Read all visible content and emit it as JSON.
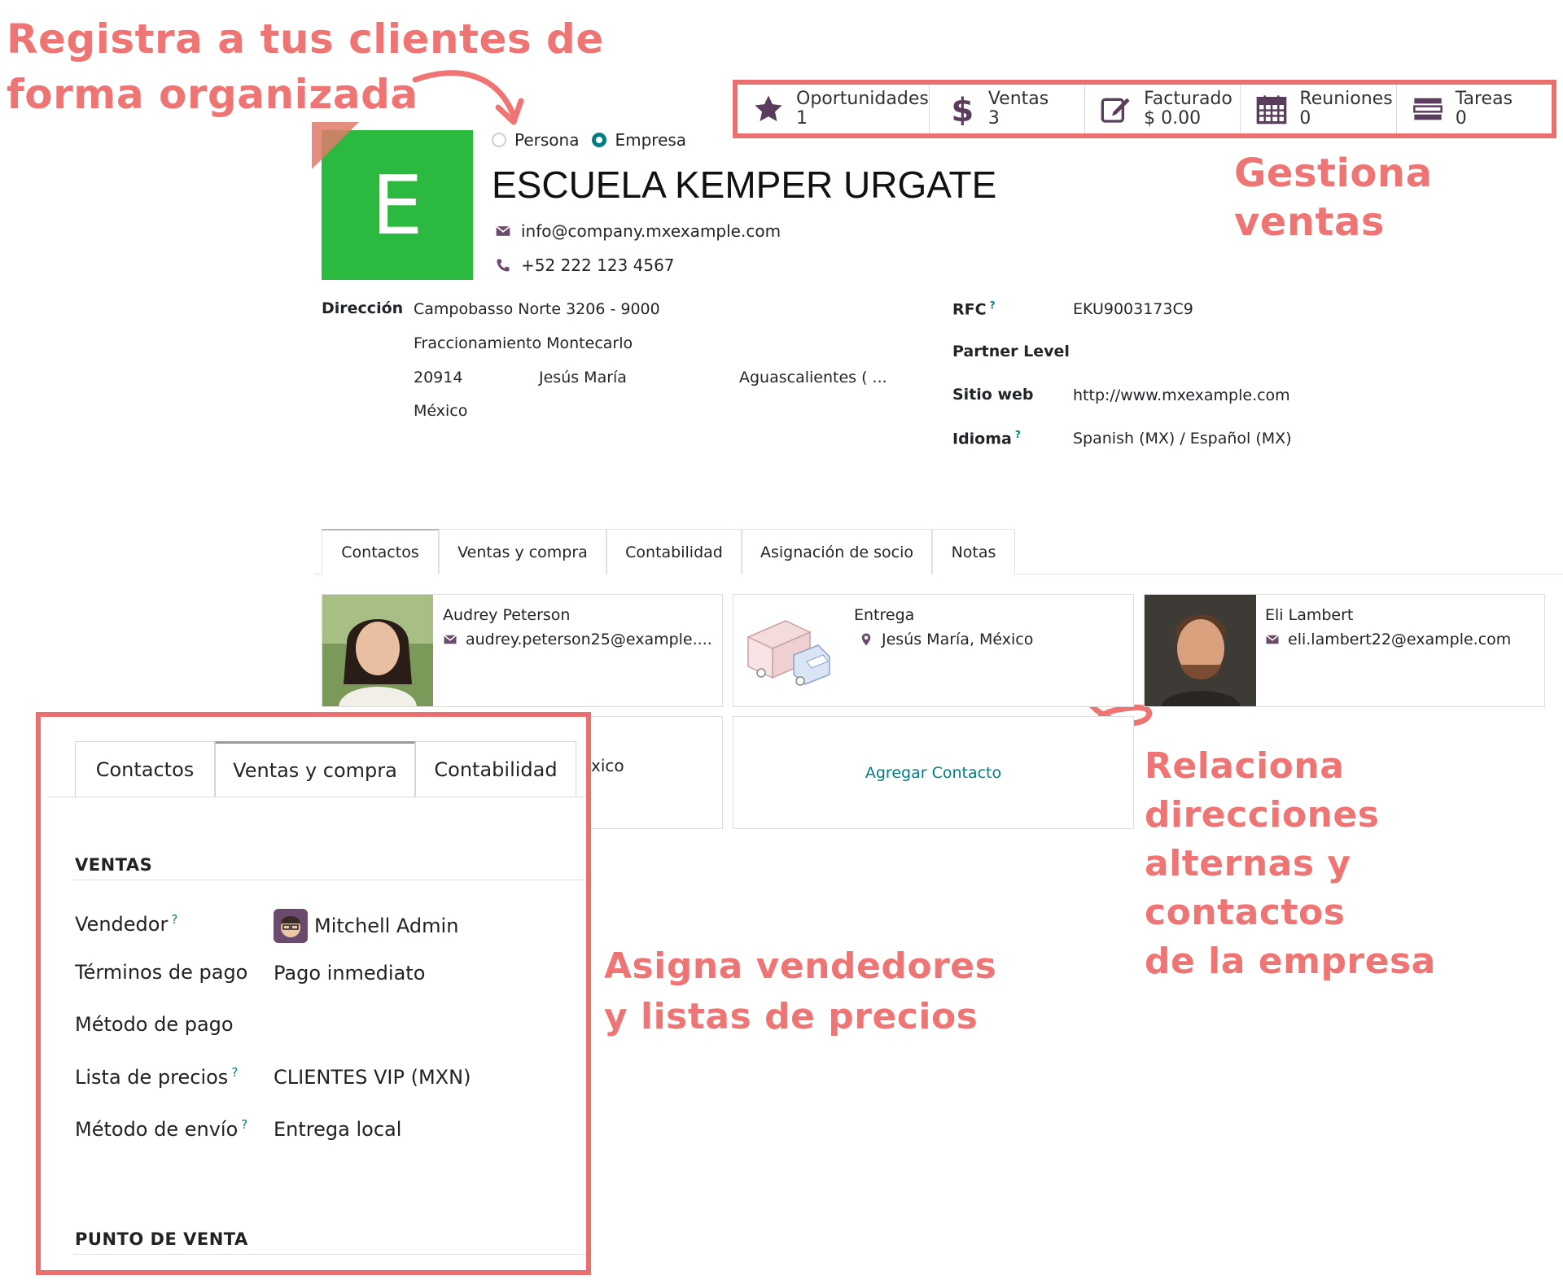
{
  "annotations": {
    "top_left": [
      "Registra a tus clientes de",
      "forma organizada"
    ],
    "sales": "Gestiona ventas",
    "relate": [
      "Relaciona direcciones",
      "alternas y contactos",
      "de la empresa"
    ],
    "assign": [
      "Asigna vendedores",
      "y listas de precios"
    ]
  },
  "smart_buttons": [
    {
      "label": "Oportunidades",
      "value": "1",
      "icon": "star-icon"
    },
    {
      "label": "Ventas",
      "value": "3",
      "icon": "dollar-icon"
    },
    {
      "label": "Facturado",
      "value": "$ 0.00",
      "icon": "invoice-edit-icon"
    },
    {
      "label": "Reuniones",
      "value": "0",
      "icon": "calendar-icon"
    },
    {
      "label": "Tareas",
      "value": "0",
      "icon": "tasks-icon"
    }
  ],
  "partner": {
    "avatar_letter": "E",
    "type_person": "Persona",
    "type_company": "Empresa",
    "name": "ESCUELA KEMPER URGATE",
    "email": "info@company.mxexample.com",
    "phone": "+52 222 123 4567"
  },
  "address": {
    "label": "Dirección",
    "street": "Campobasso Norte 3206 - 9000",
    "street2": "Fraccionamiento Montecarlo",
    "zip": "20914",
    "city": "Jesús María",
    "state": "Aguascalientes (  ...",
    "country": "México"
  },
  "right_fields": {
    "rfc_label": "RFC",
    "rfc_value": "EKU9003173C9",
    "partner_level_label": "Partner Level",
    "website_label": "Sitio web",
    "website_value": "http://www.mxexample.com",
    "lang_label": "Idioma",
    "lang_value": "Spanish (MX) / Español (MX)",
    "help_mark": "?"
  },
  "tabs": [
    "Contactos",
    "Ventas y compra",
    "Contabilidad",
    "Asignación de socio",
    "Notas"
  ],
  "contacts": [
    {
      "name": "Audrey Peterson",
      "detail": "audrey.peterson25@example...."
    },
    {
      "name": "Entrega",
      "detail": "Jesús María, México"
    },
    {
      "name": "Eli Lambert",
      "detail": "eli.lambert22@example.com"
    }
  ],
  "partial_card_text": "xico",
  "add_contact": "Agregar Contacto",
  "callout": {
    "tabs": [
      "Contactos",
      "Ventas y compra",
      "Contabilidad"
    ],
    "sales_heading": "VENTAS",
    "salesperson_label": "Vendedor",
    "salesperson_value": "Mitchell Admin",
    "payment_terms_label": "Términos de pago",
    "payment_terms_value": "Pago inmediato",
    "payment_method_label": "Método de pago",
    "pricelist_label": "Lista de precios",
    "pricelist_value": "CLIENTES VIP (MXN)",
    "delivery_label": "Método de envío",
    "delivery_value": "Entrega local",
    "pos_heading": "PUNTO DE VENTA"
  },
  "colors": {
    "accent": "#ec6f6f",
    "annotation": "#ef7474",
    "odoo_teal": "#017e84",
    "avatar_green": "#2bb940",
    "icon_purple": "#6b4a6e"
  }
}
